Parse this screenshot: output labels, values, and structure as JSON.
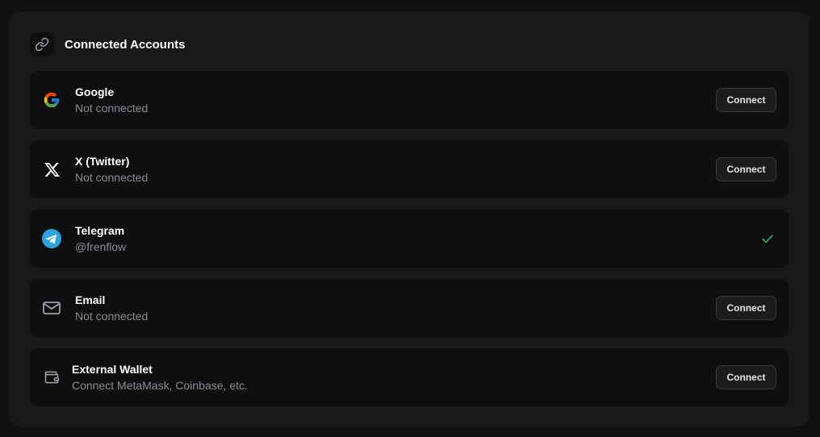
{
  "header": {
    "title": "Connected Accounts",
    "icon": "link-icon"
  },
  "accounts": [
    {
      "name": "Google",
      "status": "Not connected",
      "icon": "google-icon",
      "action": "Connect",
      "connected": false
    },
    {
      "name": "X (Twitter)",
      "status": "Not connected",
      "icon": "x-twitter-icon",
      "action": "Connect",
      "connected": false
    },
    {
      "name": "Telegram",
      "status": "@frenflow",
      "icon": "telegram-icon",
      "action": "",
      "connected": true
    },
    {
      "name": "Email",
      "status": "Not connected",
      "icon": "mail-icon",
      "action": "Connect",
      "connected": false
    },
    {
      "name": "External Wallet",
      "status": "Connect MetaMask, Coinbase, etc.",
      "icon": "wallet-icon",
      "action": "Connect",
      "connected": false
    }
  ],
  "colors": {
    "background": "#111113",
    "panel": "#19191c",
    "row": "#0f0f11",
    "success": "#22c55e",
    "telegram": "#2aa3e0"
  }
}
